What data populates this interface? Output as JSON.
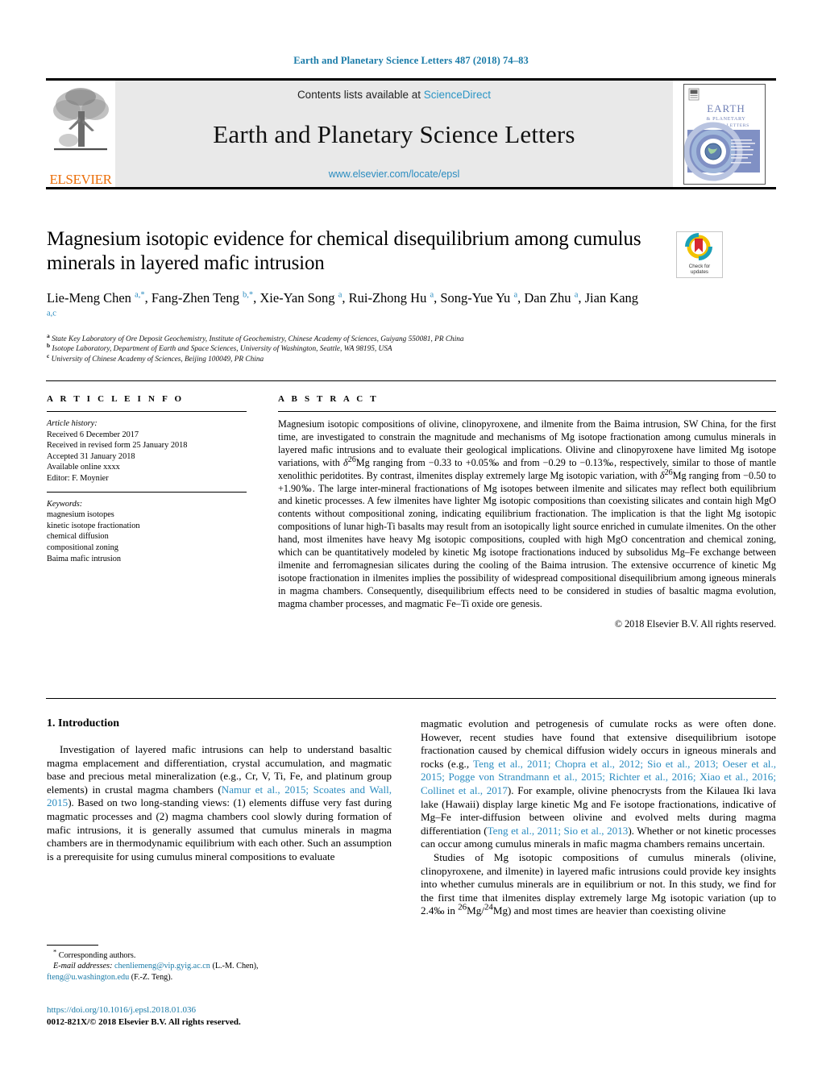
{
  "running_head": "Earth and Planetary Science Letters 487 (2018) 74–83",
  "masthead": {
    "contents_prefix": "Contents lists available at ",
    "sciencedirect": "ScienceDirect",
    "journal_title": "Earth and Planetary Science Letters",
    "journal_url": "www.elsevier.com/locate/epsl",
    "publisher": "ELSEVIER",
    "cover_title_line1": "EARTH",
    "cover_title_line2": "& PLANETARY",
    "cover_title_line3": "SCIENCE LETTERS"
  },
  "article": {
    "title": "Magnesium isotopic evidence for chemical disequilibrium among cumulus minerals in layered mafic intrusion",
    "authors_html": "Lie-Meng Chen <sup>a,*</sup>, Fang-Zhen Teng <sup>b,*</sup>, Xie-Yan Song <sup>a</sup>, Rui-Zhong Hu <sup>a</sup>, Song-Yue Yu <sup>a</sup>, Dan Zhu <sup>a</sup>, Jian Kang <sup>a,c</sup>",
    "affiliations": [
      "State Key Laboratory of Ore Deposit Geochemistry, Institute of Geochemistry, Chinese Academy of Sciences, Guiyang 550081, PR China",
      "Isotope Laboratory, Department of Earth and Space Sciences, University of Washington, Seattle, WA 98195, USA",
      "University of Chinese Academy of Sciences, Beijing 100049, PR China"
    ],
    "affiliation_marks": [
      "a",
      "b",
      "c"
    ]
  },
  "crossmark": {
    "label_line1": "Check for",
    "label_line2": "updates",
    "ring_color": "#f2c200",
    "arc_color": "#1aa0b8",
    "bookmark_color": "#d7282f"
  },
  "article_info": {
    "heading": "A R T I C L E    I N F O",
    "history_label": "Article history:",
    "history": [
      "Received 6 December 2017",
      "Received in revised form 25 January 2018",
      "Accepted 31 January 2018",
      "Available online xxxx",
      "Editor: F. Moynier"
    ],
    "keywords_label": "Keywords:",
    "keywords": [
      "magnesium isotopes",
      "kinetic isotope fractionation",
      "chemical diffusion",
      "compositional zoning",
      "Baima mafic intrusion"
    ]
  },
  "abstract": {
    "heading": "A B S T R A C T",
    "text_html": "Magnesium isotopic compositions of olivine, clinopyroxene, and ilmenite from the Baima intrusion, SW China, for the first time, are investigated to constrain the magnitude and mechanisms of Mg isotope fractionation among cumulus minerals in layered mafic intrusions and to evaluate their geological implications. Olivine and clinopyroxene have limited Mg isotope variations, with <i>&delta;</i><sup>26</sup>Mg ranging from &minus;0.33 to +0.05&permil; and from &minus;0.29 to &minus;0.13&permil;, respectively, similar to those of mantle xenolithic peridotites. By contrast, ilmenites display extremely large Mg isotopic variation, with <i>&delta;</i><sup>26</sup>Mg ranging from &minus;0.50 to +1.90&permil;. The large inter-mineral fractionations of Mg isotopes between ilmenite and silicates may reflect both equilibrium and kinetic processes. A few ilmenites have lighter Mg isotopic compositions than coexisting silicates and contain high MgO contents without compositional zoning, indicating equilibrium fractionation. The implication is that the light Mg isotopic compositions of lunar high-Ti basalts may result from an isotopically light source enriched in cumulate ilmenites. On the other hand, most ilmenites have heavy Mg isotopic compositions, coupled with high MgO concentration and chemical zoning, which can be quantitatively modeled by kinetic Mg isotope fractionations induced by subsolidus Mg&ndash;Fe exchange between ilmenite and ferromagnesian silicates during the cooling of the Baima intrusion. The extensive occurrence of kinetic Mg isotope fractionation in ilmenites implies the possibility of widespread compositional disequilibrium among igneous minerals in magma chambers. Consequently, disequilibrium effects need to be considered in studies of basaltic magma evolution, magma chamber processes, and magmatic Fe&ndash;Ti oxide ore genesis.",
    "rights": "© 2018 Elsevier B.V. All rights reserved."
  },
  "body": {
    "section_heading": "1. Introduction",
    "left_paragraph_html": "Investigation of layered mafic intrusions can help to understand basaltic magma emplacement and differentiation, crystal accumulation, and magmatic base and precious metal mineralization (e.g., Cr, V, Ti, Fe, and platinum group elements) in crustal magma chambers (<span class=\"cite\">Namur et al., 2015; Scoates and Wall, 2015</span>). Based on two long-standing views: (1) elements diffuse very fast during magmatic processes and (2) magma chambers cool slowly during formation of mafic intrusions, it is generally assumed that cumulus minerals in magma chambers are in thermodynamic equilibrium with each other. Such an assumption is a prerequisite for using cumulus mineral compositions to evaluate",
    "right_paragraph1_html": "magmatic evolution and petrogenesis of cumulate rocks as were often done. However, recent studies have found that extensive disequilibrium isotope fractionation caused by chemical diffusion widely occurs in igneous minerals and rocks (e.g., <span class=\"cite\">Teng et al., 2011; Chopra et al., 2012; Sio et al., 2013; Oeser et al., 2015; Pogge von Strandmann et al., 2015; Richter et al., 2016; Xiao et al., 2016; Collinet et al., 2017</span>). For example, olivine phenocrysts from the Kilauea Iki lava lake (Hawaii) display large kinetic Mg and Fe isotope fractionations, indicative of Mg&ndash;Fe inter-diffusion between olivine and evolved melts during magma differentiation (<span class=\"cite\">Teng et al., 2011; Sio et al., 2013</span>). Whether or not kinetic processes can occur among cumulus minerals in mafic magma chambers remains uncertain.",
    "right_paragraph2_html": "Studies of Mg isotopic compositions of cumulus minerals (olivine, clinopyroxene, and ilmenite) in layered mafic intrusions could provide key insights into whether cumulus minerals are in equilibrium or not. In this study, we find for the first time that ilmenites display extremely large Mg isotopic variation (up to 2.4&permil; in <sup>26</sup>Mg/<sup>24</sup>Mg) and most times are heavier than coexisting olivine"
  },
  "footnote": {
    "asterisk": "*",
    "corresponding": "Corresponding authors.",
    "email_label": "E-mail addresses:",
    "email1": "chenliemeng@vip.gyig.ac.cn",
    "email1_owner": "(L.-M. Chen),",
    "email2": "fteng@u.washington.edu",
    "email2_owner": "(F.-Z. Teng)."
  },
  "imprint": {
    "doi": "https://doi.org/10.1016/j.epsl.2018.01.036",
    "issn_line": "0012-821X/© 2018 Elsevier B.V. All rights reserved."
  }
}
